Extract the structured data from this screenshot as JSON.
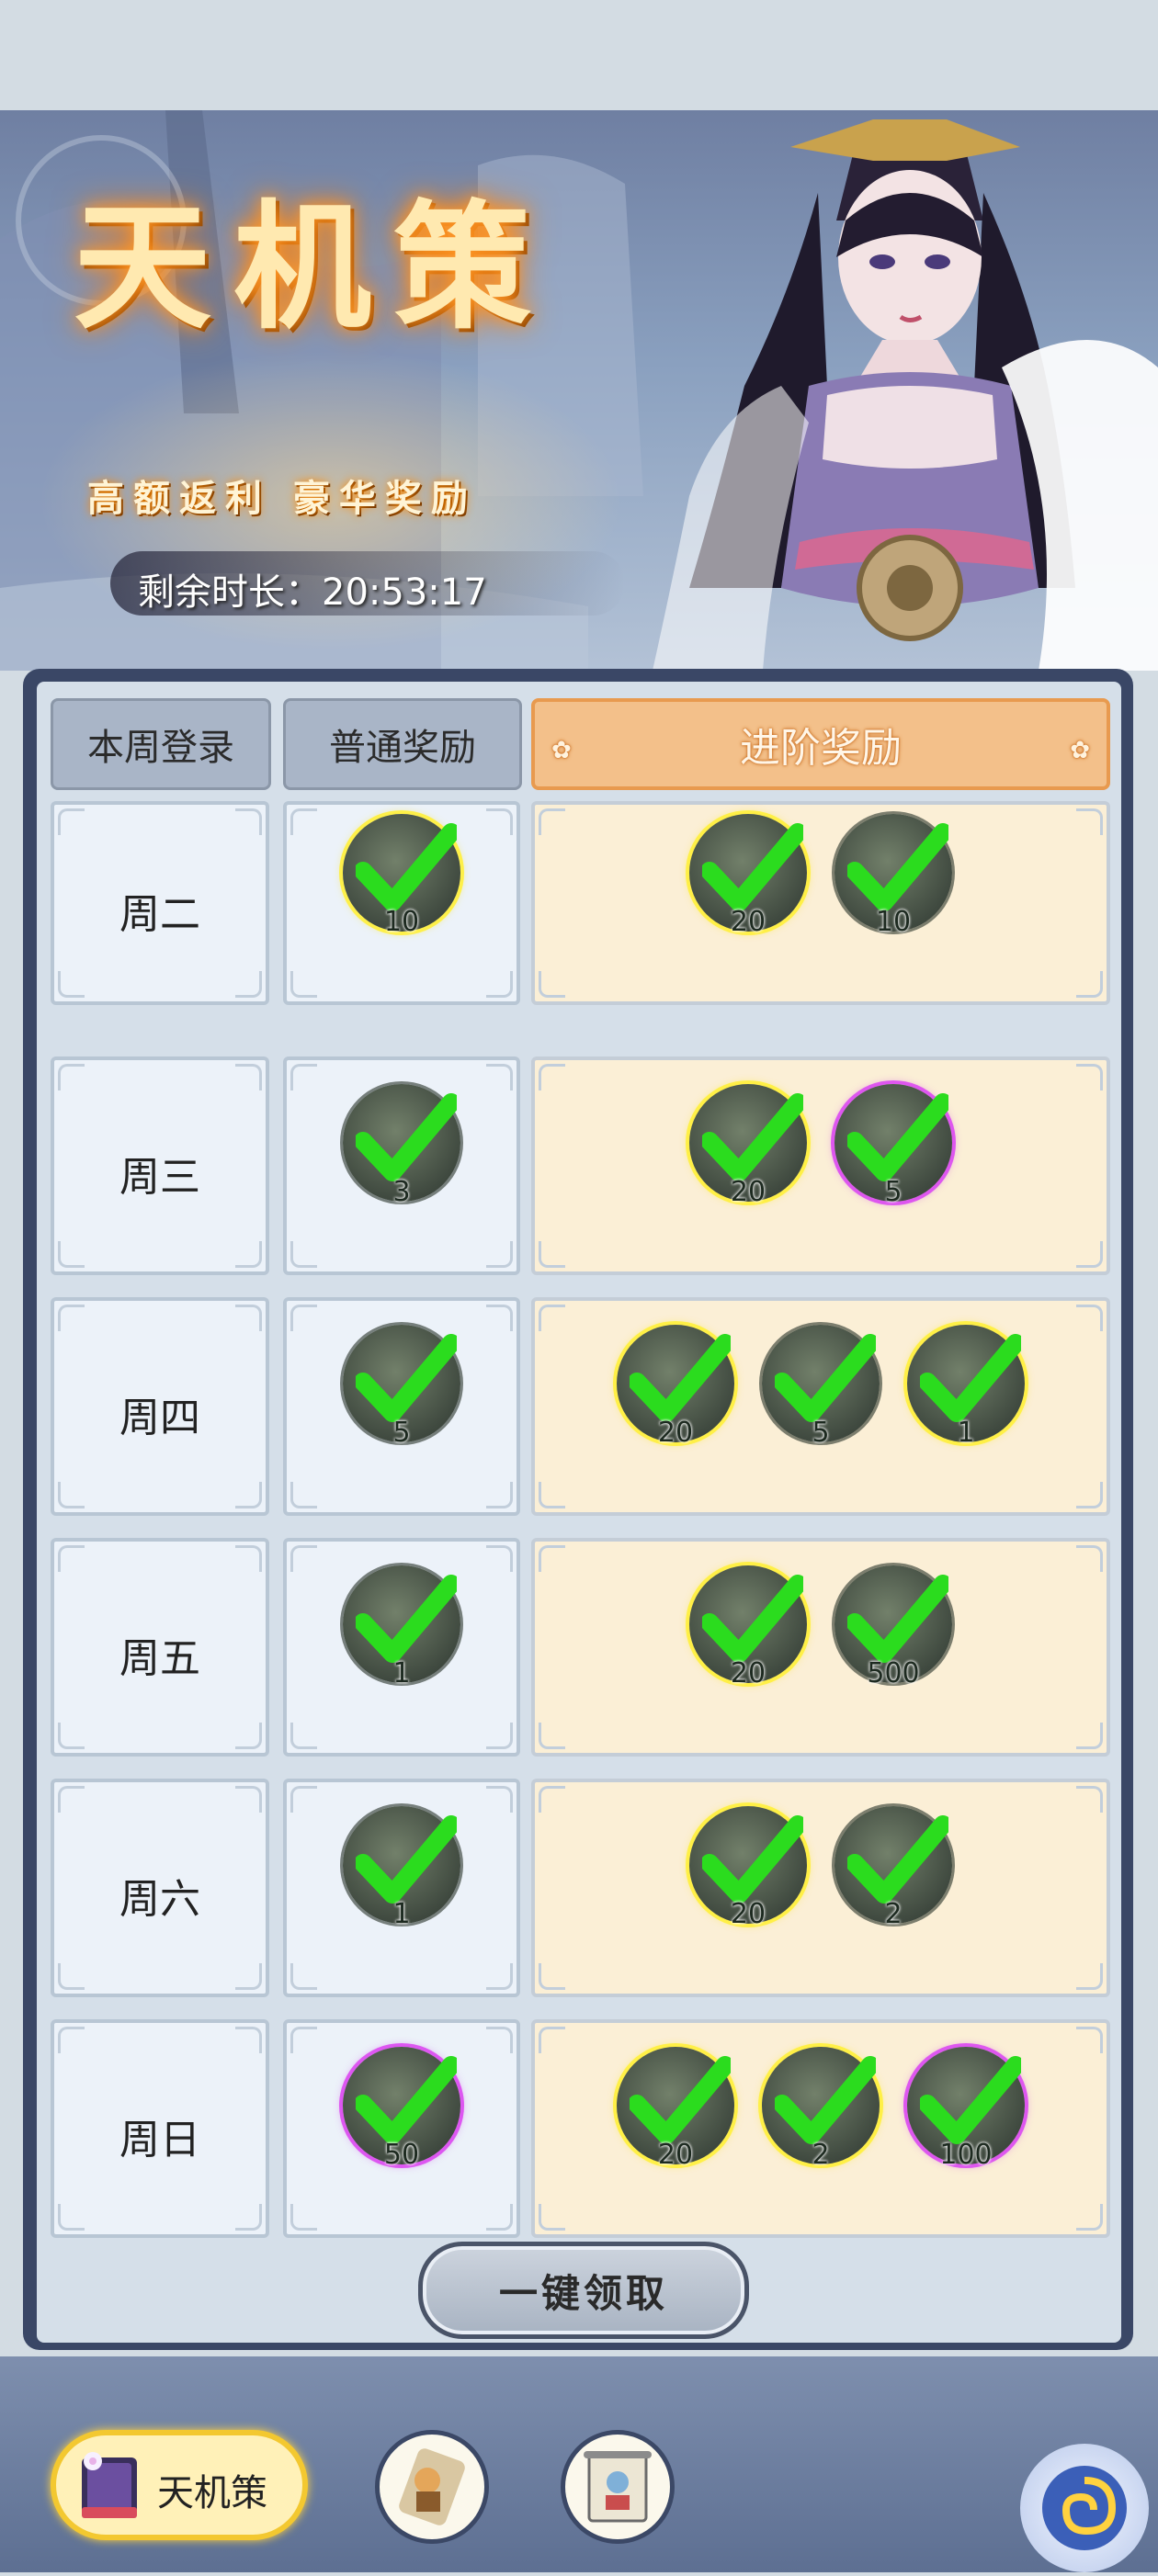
{
  "event": {
    "title": "天机策",
    "subtitle": "高额返利 豪华奖励",
    "timer_label": "剩余时长：",
    "timer_value": "20:53:17"
  },
  "tabs": {
    "login": "本周登录",
    "normal": "普通奖励",
    "advanced": "进阶奖励"
  },
  "rows": [
    {
      "day": "周二",
      "normal": [
        {
          "count": "10",
          "icon": "bowl-icon",
          "rarity": "gold"
        }
      ],
      "advanced": [
        {
          "count": "20",
          "icon": "bowl-icon",
          "rarity": "gold"
        },
        {
          "count": "10",
          "icon": "potion-icon",
          "rarity": "none"
        }
      ]
    },
    {
      "day": "周三",
      "normal": [
        {
          "count": "3",
          "icon": "potion-icon",
          "rarity": "none"
        }
      ],
      "advanced": [
        {
          "count": "20",
          "icon": "bowl-icon",
          "rarity": "gold"
        },
        {
          "count": "5",
          "icon": "pouch-icon",
          "rarity": "purple"
        }
      ]
    },
    {
      "day": "周四",
      "normal": [
        {
          "count": "5",
          "icon": "scroll-piece-icon",
          "rarity": "none"
        }
      ],
      "advanced": [
        {
          "count": "20",
          "icon": "bowl-icon",
          "rarity": "gold"
        },
        {
          "count": "5",
          "icon": "scroll-piece-icon",
          "rarity": "none"
        },
        {
          "count": "1",
          "icon": "orb-icon",
          "rarity": "gold"
        }
      ]
    },
    {
      "day": "周五",
      "normal": [
        {
          "count": "1",
          "icon": "talisman-icon",
          "rarity": "none"
        }
      ],
      "advanced": [
        {
          "count": "20",
          "icon": "bowl-icon",
          "rarity": "gold"
        },
        {
          "count": "500",
          "icon": "jade-gem-icon",
          "rarity": "none"
        }
      ]
    },
    {
      "day": "周六",
      "normal": [
        {
          "count": "1",
          "icon": "hammer-icon",
          "rarity": "none"
        }
      ],
      "advanced": [
        {
          "count": "20",
          "icon": "bowl-icon",
          "rarity": "gold"
        },
        {
          "count": "2",
          "icon": "hammer-icon",
          "rarity": "none"
        }
      ]
    },
    {
      "day": "周日",
      "normal": [
        {
          "count": "50",
          "icon": "fragment-icon",
          "rarity": "purple"
        }
      ],
      "advanced": [
        {
          "count": "20",
          "icon": "bowl-icon",
          "rarity": "gold"
        },
        {
          "count": "2",
          "icon": "fragment-icon",
          "rarity": "gold"
        },
        {
          "count": "100",
          "icon": "fragment-icon",
          "rarity": "purple"
        }
      ]
    }
  ],
  "claim_all": "一键领取",
  "bottom_nav": {
    "main_label": "天机策",
    "main_icon": "book-icon",
    "nav2_icon": "scroll-figure-icon",
    "nav3_icon": "painting-scroll-icon",
    "corner_icon": "swirl-icon"
  },
  "colors": {
    "panel_frame": "#3a4766",
    "panel_bg": "#d5dfe9",
    "cell_bg": "#ecf2f9",
    "advanced_cell_bg": "#fbefd6",
    "active_tab": "#f3c08a",
    "check": "#2bdc1e",
    "gold_ring": "#fff03c",
    "purple_ring": "#dc50f0"
  }
}
